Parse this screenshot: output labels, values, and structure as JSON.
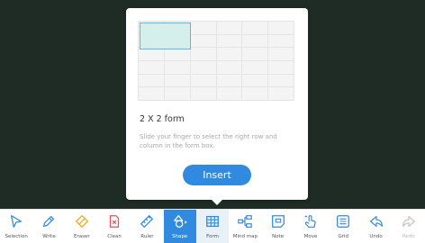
{
  "popup": {
    "title": "2 X 2 form",
    "hint": "Slide your finger to select the right row and column in the form box.",
    "insert_label": "Insert"
  },
  "toolbar": {
    "items": [
      {
        "label": "Selection",
        "icon": "cursor-icon"
      },
      {
        "label": "Write",
        "icon": "pen-icon"
      },
      {
        "label": "Eraser",
        "icon": "eraser-icon"
      },
      {
        "label": "Clean",
        "icon": "clean-icon"
      },
      {
        "label": "Ruler",
        "icon": "ruler-icon"
      },
      {
        "label": "Shape",
        "icon": "shape-icon"
      },
      {
        "label": "Form",
        "icon": "table-icon"
      },
      {
        "label": "Mind map",
        "icon": "mindmap-icon"
      },
      {
        "label": "Note",
        "icon": "note-icon"
      },
      {
        "label": "Move",
        "icon": "hand-icon"
      },
      {
        "label": "Grid",
        "icon": "grid-icon"
      },
      {
        "label": "Undo",
        "icon": "undo-icon"
      },
      {
        "label": "Redo",
        "icon": "redo-icon"
      }
    ]
  },
  "colors": {
    "board": "#1f2c26",
    "accent": "#2f8ae0",
    "icon": "#2f8ae0",
    "eraser": "#f5a623",
    "clean": "#e8535b",
    "disabled": "#c0c0c0"
  }
}
